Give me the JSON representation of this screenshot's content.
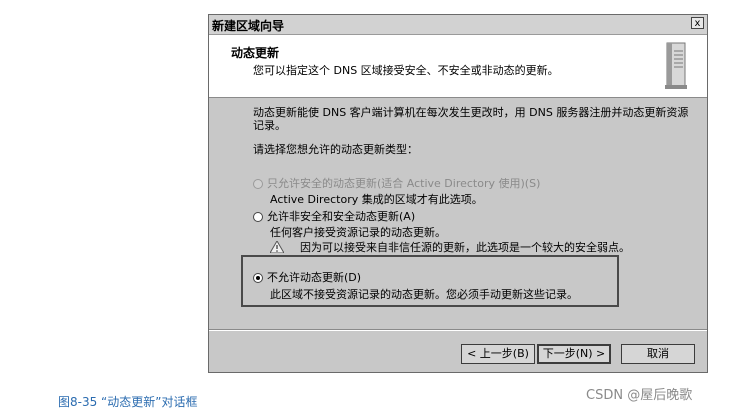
{
  "window": {
    "title": "新建区域向导",
    "close_glyph": "x"
  },
  "header": {
    "title": "动态更新",
    "subtitle": "您可以指定这个 DNS 区域接受安全、不安全或非动态的更新。",
    "icon": "server-icon"
  },
  "body": {
    "description": "动态更新能使 DNS 客户端计算机在每次发生更改时，用 DNS 服务器注册并动态更新资源记录。",
    "prompt": "请选择您想允许的动态更新类型：",
    "options": [
      {
        "label": "只允许安全的动态更新(适合 Active Directory 使用)(S)",
        "detail": "Active Directory 集成的区域才有此选项。",
        "enabled": false,
        "selected": false
      },
      {
        "label": "允许非安全和安全动态更新(A)",
        "detail": "任何客户接受资源记录的动态更新。",
        "warning": "因为可以接受来自非信任源的更新，此选项是一个较大的安全弱点。",
        "enabled": true,
        "selected": false
      },
      {
        "label": "不允许动态更新(D)",
        "detail": "此区域不接受资源记录的动态更新。您必须手动更新这些记录。",
        "enabled": true,
        "selected": true
      }
    ]
  },
  "buttons": {
    "back": "< 上一步(B)",
    "next": "下一步(N) >",
    "cancel": "取消"
  },
  "caption": "图8-35  “动态更新”对话框",
  "watermark": "CSDN @屋后晚歌"
}
